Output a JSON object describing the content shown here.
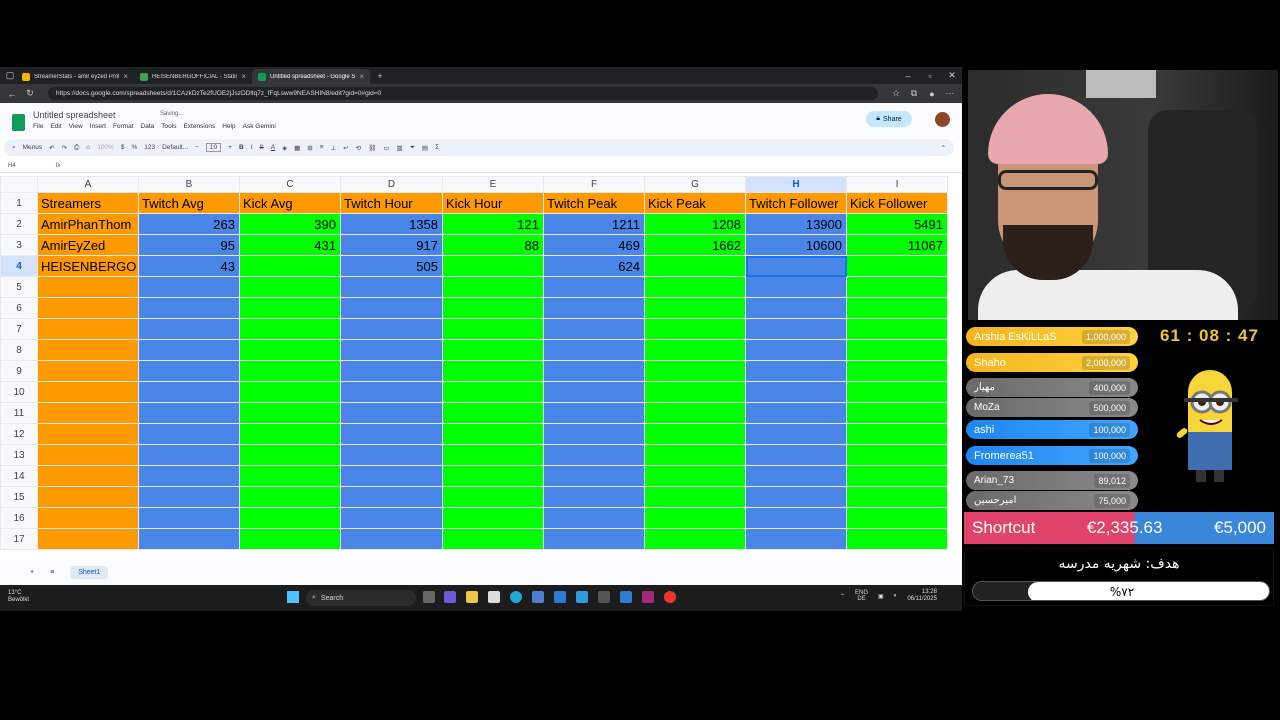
{
  "browser": {
    "tabs": [
      {
        "title": "StreamerStats - amir eyzed Profile",
        "color": "#f5b800"
      },
      {
        "title": "HEISENBERGOFFICIAL - Statistics",
        "color": "#3aa14f"
      },
      {
        "title": "Untitled spreadsheet - Google Sh",
        "color": "#0f9d58"
      }
    ],
    "url": "https://docs.google.com/spreadsheets/d/1CAzkDzTe2fUOE2jJszDDltq7z_fFqLsww9NEASHIN8/edit?gid=0#gid=0"
  },
  "sheets": {
    "doc_title": "Untitled spreadsheet",
    "saving_status": "Saving...",
    "menu": [
      "File",
      "Edit",
      "View",
      "Insert",
      "Format",
      "Data",
      "Tools",
      "Extensions",
      "Help",
      "Ask Gemini"
    ],
    "share_label": "Share",
    "toolbar": {
      "menus": "Menus",
      "zoom": "100%",
      "currency": "$",
      "percent": "%",
      "format": "123",
      "font": "Default...",
      "font_size": "10"
    },
    "cell_ref": "H4",
    "columns": [
      "A",
      "B",
      "C",
      "D",
      "E",
      "F",
      "G",
      "H",
      "I"
    ],
    "selected_col": "H",
    "headers": [
      "Streamers",
      "Twitch Avg",
      "Kick Avg",
      "Twitch Hour",
      "Kick Hour",
      "Twitch Peak",
      "Kick Peak",
      "Twitch Follower",
      "Kick Follower"
    ],
    "rows": [
      [
        "AmirPhanThom",
        "263",
        "390",
        "1358",
        "121",
        "1211",
        "1208",
        "13900",
        "5491"
      ],
      [
        "AmirEyZed",
        "95",
        "431",
        "917",
        "88",
        "469",
        "1662",
        "10600",
        "11067"
      ],
      [
        "HEISENBERGO",
        "43",
        "",
        "505",
        "",
        "624",
        "",
        "",
        ""
      ]
    ],
    "row_numbers": [
      "1",
      "2",
      "3",
      "4",
      "5",
      "6",
      "7",
      "8",
      "9",
      "10",
      "11",
      "12",
      "13",
      "14",
      "15",
      "16",
      "17"
    ],
    "sheet_tab": "Sheet1",
    "colors": {
      "orange": "#ff9900",
      "blue": "#4a86e8",
      "green": "#00ff00"
    }
  },
  "taskbar": {
    "weather_temp": "13°C",
    "weather_desc": "Bewölkt",
    "search_placeholder": "Search",
    "lang": "ENG",
    "region": "DE",
    "time": "13:28",
    "date": "06/11/2025"
  },
  "overlay": {
    "donors": [
      {
        "name": "Arshia EsKiLLaS",
        "amount": "1,000,000",
        "style": "gold"
      },
      {
        "name": "Shaho",
        "amount": "2,000,000",
        "style": "gold"
      },
      {
        "name": "مهیار",
        "amount": "400,000",
        "style": "grey"
      },
      {
        "name": "MoZa",
        "amount": "500,000",
        "style": "grey"
      },
      {
        "name": "ashi",
        "amount": "100,000",
        "style": "blue"
      },
      {
        "name": "Fromerea51",
        "amount": "100,000",
        "style": "blue"
      },
      {
        "name": "Arian_73",
        "amount": "89,012",
        "style": "grey"
      },
      {
        "name": "امیرحسین",
        "amount": "75,000",
        "style": "grey"
      }
    ],
    "timer": "61 : 08 : 47",
    "shortcut_label": "Shortcut",
    "shortcut_current": "€2,335.63",
    "shortcut_goal": "€5,000",
    "school_goal_title": "هدف: شهریه مدرسه",
    "school_goal_percent_text": "%۷۲",
    "school_goal_progress": 0.72
  }
}
